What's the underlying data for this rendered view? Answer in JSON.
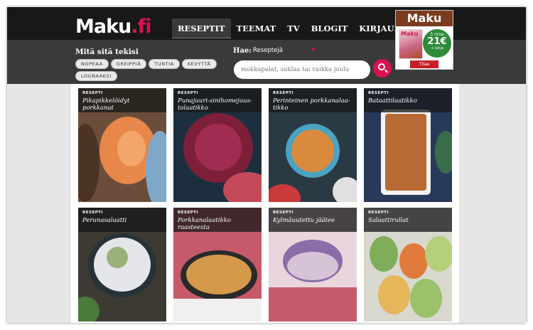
{
  "logo": {
    "text_main": "Maku",
    "text_dot": ".fi"
  },
  "nav": {
    "items": [
      {
        "label": "RESEPTIT",
        "active": true
      },
      {
        "label": "TEEMAT",
        "active": false
      },
      {
        "label": "TV",
        "active": false
      },
      {
        "label": "BLOGIT",
        "active": false
      },
      {
        "label": "KIRJAUDU",
        "active": false
      }
    ]
  },
  "ad": {
    "brand": "Maku",
    "mag_brand": "Maku",
    "badge_count": "5 nroa",
    "badge_price": "21€",
    "badge_extra": "+ lahja",
    "button": "Tilaa"
  },
  "filters": {
    "title": "Mitä sitä tekisi",
    "tags": [
      "NOPEAA",
      "GREIPPIÄ",
      "TUNTIA",
      "KEVYTTÄ",
      "LOUNAAKSI"
    ]
  },
  "search": {
    "label": "Hae:",
    "selected": "Reseptejä",
    "placeholder": "mokkapalat, suklaa tai vaikka joulu"
  },
  "cards": [
    {
      "tag": "RESEPTI",
      "title": "Pikapikkelöidyt porkkanat"
    },
    {
      "tag": "RESEPTI",
      "title": "Punajuuri-sinihomejuus-tolaatikko"
    },
    {
      "tag": "RESEPTI",
      "title": "Perinteinen porkkanalaa-tikko"
    },
    {
      "tag": "RESEPTI",
      "title": "Bataattilaatikko"
    },
    {
      "tag": "RESEPTI",
      "title": "Perunasalaatti"
    },
    {
      "tag": "RESEPTI",
      "title": "Porkkanalaatikko raasteesta"
    },
    {
      "tag": "RESEPTI",
      "title": "Kylmäuutettu jäätee"
    },
    {
      "tag": "RESEPTI",
      "title": "Salaattirullat"
    }
  ],
  "colors": {
    "accent": "#d9124d",
    "topbar": "#181818",
    "subbar": "#3a3a3a"
  }
}
